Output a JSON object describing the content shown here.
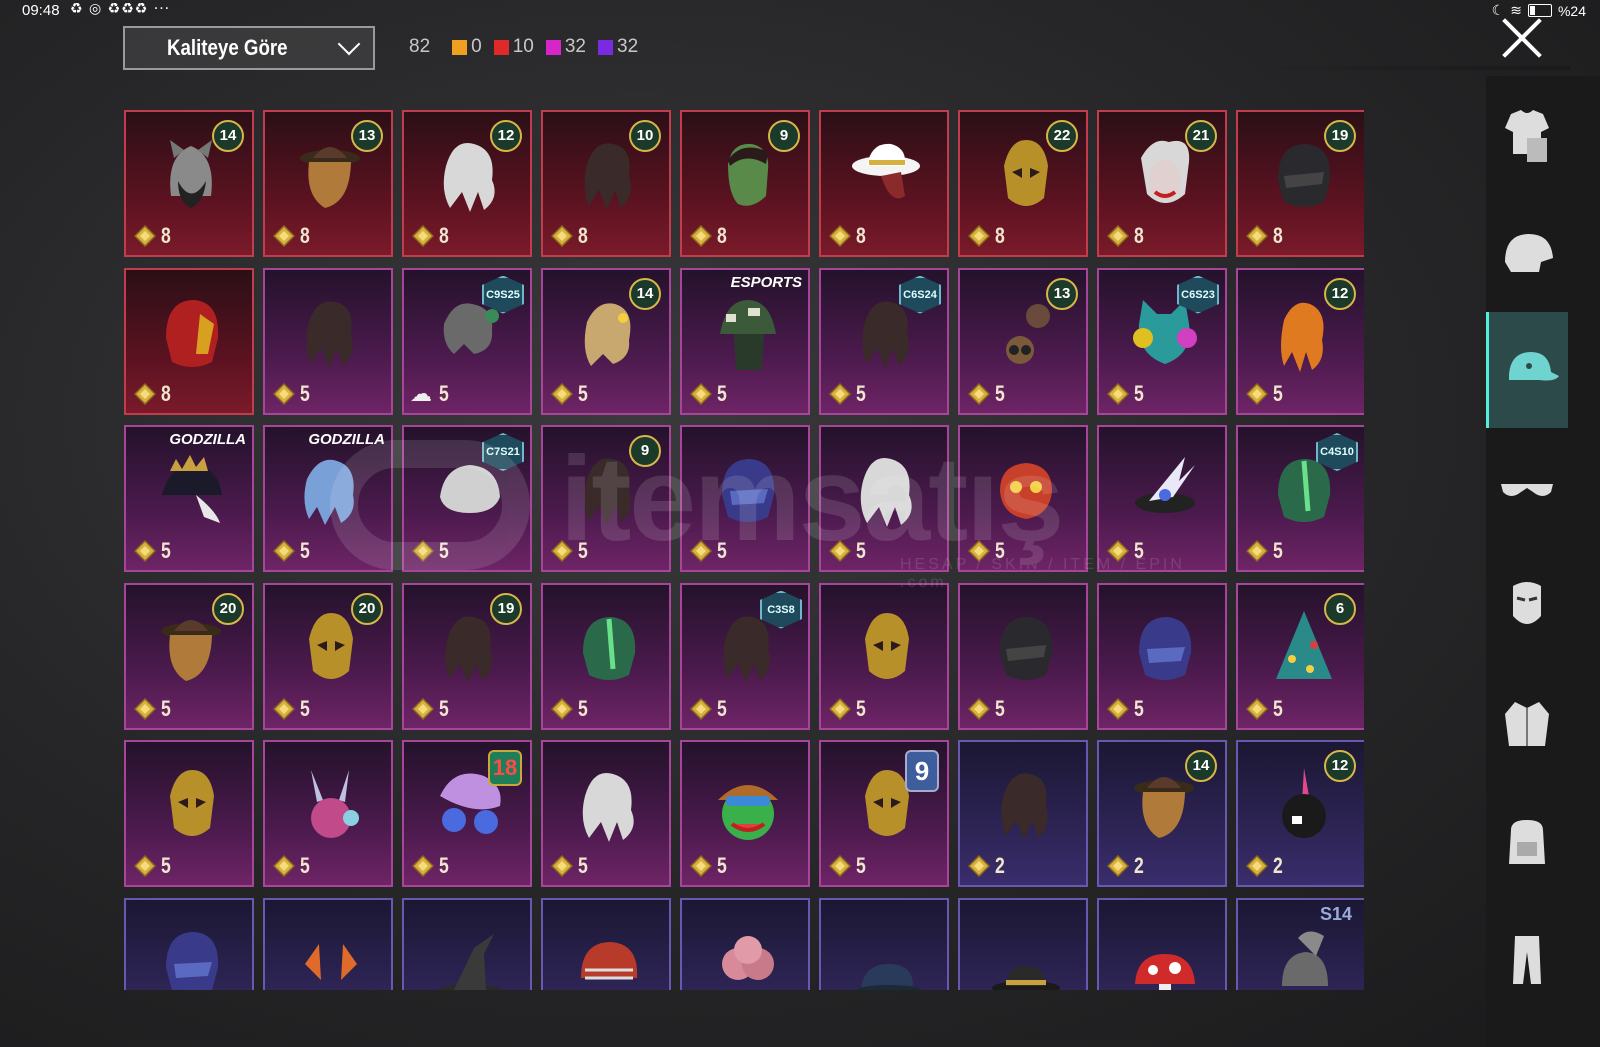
{
  "status_bar": {
    "time": "09:48",
    "icons": "♻ ◎ ♻♻♻ ···",
    "battery": "%24"
  },
  "toolbar": {
    "sort_label": "Kaliteye Göre",
    "total": "82",
    "counts": [
      {
        "color": "#f0a020",
        "value": "0"
      },
      {
        "color": "#e02a2a",
        "value": "10"
      },
      {
        "color": "#d626c9",
        "value": "32"
      },
      {
        "color": "#7a2ae0",
        "value": "32"
      }
    ]
  },
  "watermark": {
    "text": "itemsatış",
    "sub": "HESAP / SKIN / ITEM / EPIN",
    "domain": ".com"
  },
  "items": [
    {
      "rarity": "red",
      "qty": "8",
      "badge": "lvl",
      "badge_text": "14",
      "art": "hood"
    },
    {
      "rarity": "red",
      "qty": "8",
      "badge": "lvl",
      "badge_text": "13",
      "art": "hat-hair"
    },
    {
      "rarity": "red",
      "qty": "8",
      "badge": "lvl",
      "badge_text": "12",
      "art": "hair-white"
    },
    {
      "rarity": "red",
      "qty": "8",
      "badge": "lvl",
      "badge_text": "10",
      "art": "hair-dark"
    },
    {
      "rarity": "red",
      "qty": "8",
      "badge": "lvl",
      "badge_text": "9",
      "art": "zombie"
    },
    {
      "rarity": "red",
      "qty": "8",
      "badge": "none",
      "badge_text": "",
      "art": "cowboy"
    },
    {
      "rarity": "red",
      "qty": "8",
      "badge": "lvl",
      "badge_text": "22",
      "art": "gold-mask"
    },
    {
      "rarity": "red",
      "qty": "8",
      "badge": "lvl",
      "badge_text": "21",
      "art": "joker"
    },
    {
      "rarity": "red",
      "qty": "8",
      "badge": "lvl",
      "badge_text": "19",
      "art": "helmet-dark"
    },
    {
      "rarity": "red",
      "qty": "8",
      "badge": "none",
      "badge_text": "",
      "art": "helmet-red"
    },
    {
      "rarity": "pink",
      "qty": "5",
      "badge": "none",
      "badge_text": "",
      "art": "hair-dark"
    },
    {
      "rarity": "pink",
      "qty": "5",
      "badge": "season",
      "badge_text": "C9S25",
      "art": "hair-grey",
      "cloud": true
    },
    {
      "rarity": "pink",
      "qty": "5",
      "badge": "lvl",
      "badge_text": "14",
      "art": "hair-blonde"
    },
    {
      "rarity": "pink",
      "qty": "5",
      "badge": "brand",
      "badge_text": "ESPORTS",
      "art": "bucket-hat"
    },
    {
      "rarity": "pink",
      "qty": "5",
      "badge": "season",
      "badge_text": "C6S24",
      "art": "hair-dark"
    },
    {
      "rarity": "pink",
      "qty": "5",
      "badge": "lvl",
      "badge_text": "13",
      "art": "goggles"
    },
    {
      "rarity": "pink",
      "qty": "5",
      "badge": "season",
      "badge_text": "C6S23",
      "art": "cat-headset"
    },
    {
      "rarity": "pink",
      "qty": "5",
      "badge": "lvl",
      "badge_text": "12",
      "art": "hair-orange"
    },
    {
      "rarity": "pink",
      "qty": "5",
      "badge": "brand",
      "badge_text": "GODZILLA",
      "art": "spike-cap"
    },
    {
      "rarity": "pink",
      "qty": "5",
      "badge": "brand",
      "badge_text": "GODZILLA",
      "art": "hair-blue"
    },
    {
      "rarity": "pink",
      "qty": "5",
      "badge": "season",
      "badge_text": "C7S21",
      "art": "hair-silver"
    },
    {
      "rarity": "pink",
      "qty": "5",
      "badge": "lvl",
      "badge_text": "9",
      "art": "hair-dark"
    },
    {
      "rarity": "pink",
      "qty": "5",
      "badge": "none",
      "badge_text": "",
      "art": "helmet-blue"
    },
    {
      "rarity": "pink",
      "qty": "5",
      "badge": "none",
      "badge_text": "",
      "art": "hair-white"
    },
    {
      "rarity": "pink",
      "qty": "5",
      "badge": "none",
      "badge_text": "",
      "art": "dragon"
    },
    {
      "rarity": "pink",
      "qty": "5",
      "badge": "none",
      "badge_text": "",
      "art": "feather-hat"
    },
    {
      "rarity": "pink",
      "qty": "5",
      "badge": "season",
      "badge_text": "C4S10",
      "art": "helmet-green"
    },
    {
      "rarity": "pink",
      "qty": "5",
      "badge": "lvl",
      "badge_text": "20",
      "art": "hat-hair"
    },
    {
      "rarity": "pink",
      "qty": "5",
      "badge": "lvl",
      "badge_text": "20",
      "art": "gold-mask"
    },
    {
      "rarity": "pink",
      "qty": "5",
      "badge": "lvl",
      "badge_text": "19",
      "art": "hair-dark"
    },
    {
      "rarity": "pink",
      "qty": "5",
      "badge": "none",
      "badge_text": "",
      "art": "helmet-green"
    },
    {
      "rarity": "pink",
      "qty": "5",
      "badge": "season",
      "badge_text": "C3S8",
      "art": "hair-dark"
    },
    {
      "rarity": "pink",
      "qty": "5",
      "badge": "none",
      "badge_text": "",
      "art": "gold-mask"
    },
    {
      "rarity": "pink",
      "qty": "5",
      "badge": "none",
      "badge_text": "",
      "art": "helmet-dark"
    },
    {
      "rarity": "pink",
      "qty": "5",
      "badge": "none",
      "badge_text": "",
      "art": "helmet-blue"
    },
    {
      "rarity": "pink",
      "qty": "5",
      "badge": "lvl",
      "badge_text": "6",
      "art": "tree-hat"
    },
    {
      "rarity": "pink",
      "qty": "5",
      "badge": "none",
      "badge_text": "",
      "art": "gold-mask"
    },
    {
      "rarity": "pink",
      "qty": "5",
      "badge": "none",
      "badge_text": "",
      "art": "bunny-pink"
    },
    {
      "rarity": "pink",
      "qty": "5",
      "badge": "badge18",
      "badge_text": "18",
      "art": "helmet-purple"
    },
    {
      "rarity": "pink",
      "qty": "5",
      "badge": "none",
      "badge_text": "",
      "art": "hair-white"
    },
    {
      "rarity": "pink",
      "qty": "5",
      "badge": "none",
      "badge_text": "",
      "art": "frog"
    },
    {
      "rarity": "pink",
      "qty": "5",
      "badge": "badge9",
      "badge_text": "9",
      "art": "gold-mask"
    },
    {
      "rarity": "purple",
      "qty": "2",
      "badge": "none",
      "badge_text": "",
      "art": "hair-dark"
    },
    {
      "rarity": "purple",
      "qty": "2",
      "badge": "lvl",
      "badge_text": "14",
      "art": "hat-hair"
    },
    {
      "rarity": "purple",
      "qty": "2",
      "badge": "lvl",
      "badge_text": "12",
      "art": "bunny-black"
    },
    {
      "rarity": "purple",
      "qty": "",
      "badge": "none",
      "badge_text": "",
      "art": "helmet-blue"
    },
    {
      "rarity": "purple",
      "qty": "",
      "badge": "none",
      "badge_text": "",
      "art": "horns"
    },
    {
      "rarity": "purple",
      "qty": "",
      "badge": "none",
      "badge_text": "",
      "art": "witch-hat"
    },
    {
      "rarity": "purple",
      "qty": "",
      "badge": "none",
      "badge_text": "",
      "art": "football"
    },
    {
      "rarity": "purple",
      "qty": "",
      "badge": "none",
      "badge_text": "",
      "art": "hair-pink"
    },
    {
      "rarity": "purple",
      "qty": "",
      "badge": "none",
      "badge_text": "",
      "art": "cap"
    },
    {
      "rarity": "purple",
      "qty": "",
      "badge": "none",
      "badge_text": "",
      "art": "fedora"
    },
    {
      "rarity": "purple",
      "qty": "",
      "badge": "none",
      "badge_text": "",
      "art": "mushroom"
    },
    {
      "rarity": "purple",
      "qty": "",
      "badge": "s14",
      "badge_text": "S14",
      "art": "spartan"
    }
  ],
  "sidebar": [
    {
      "icon": "outfit-icon",
      "active": false
    },
    {
      "icon": "helmet-icon",
      "active": false
    },
    {
      "icon": "cap-icon",
      "active": true
    },
    {
      "icon": "glasses-icon",
      "active": false
    },
    {
      "icon": "mask-icon",
      "active": false
    },
    {
      "icon": "jacket-icon",
      "active": false
    },
    {
      "icon": "backpack-icon",
      "active": false
    },
    {
      "icon": "pants-icon",
      "active": false
    }
  ]
}
